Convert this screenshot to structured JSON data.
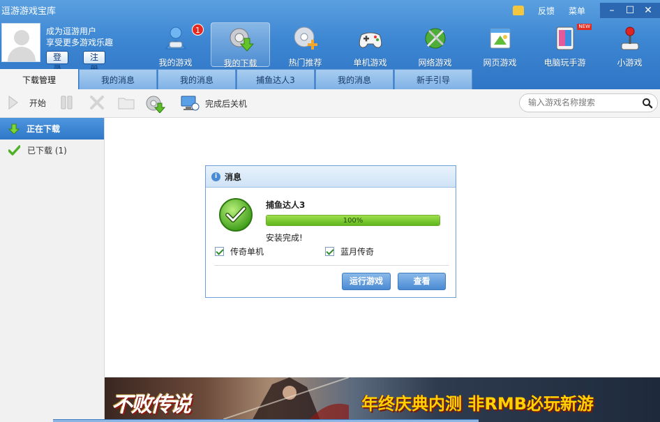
{
  "app": {
    "title": "逗游游戏宝库"
  },
  "system": {
    "feedback": "反馈",
    "menu": "菜单",
    "shirt_icon": "shirt-icon",
    "min": "–",
    "max": "☐",
    "close": "✕"
  },
  "user": {
    "line1": "成为逗游用户",
    "line2": "享受更多游戏乐趣",
    "login": "登录",
    "register": "注册"
  },
  "nav": [
    {
      "label": "我的游戏",
      "badge": "1",
      "icon": "my-games-icon"
    },
    {
      "label": "我的下载",
      "icon": "download-gear-icon",
      "active": true
    },
    {
      "label": "热门推荐",
      "icon": "hot-recommend-icon"
    },
    {
      "label": "单机游戏",
      "icon": "gamepad-icon"
    },
    {
      "label": "网络游戏",
      "icon": "sword-globe-icon"
    },
    {
      "label": "网页游戏",
      "icon": "web-game-icon"
    },
    {
      "label": "电脑玩手游",
      "icon": "tablet-icon",
      "tag": "NEW"
    },
    {
      "label": "小游戏",
      "icon": "joystick-icon"
    }
  ],
  "tabs": [
    {
      "label": "下载管理",
      "active": true
    },
    {
      "label": "我的消息"
    },
    {
      "label": "我的消息"
    },
    {
      "label": "捕鱼达人3"
    },
    {
      "label": "我的消息"
    },
    {
      "label": "新手引导"
    }
  ],
  "toolbar": {
    "start": "开始",
    "shutdown_after": "完成后关机"
  },
  "search": {
    "placeholder": "输入游戏名称搜索"
  },
  "sidebar": {
    "downloading": "正在下载",
    "downloaded": "已下载 (1)"
  },
  "dialog": {
    "title": "消息",
    "game": "捕鱼达人3",
    "progress": 100,
    "progress_text": "100%",
    "status": "安装完成!",
    "option1": "传奇单机",
    "option2": "蓝月传奇",
    "run_button": "运行游戏",
    "view_button": "查看"
  },
  "banner": {
    "logo": "不败传说",
    "slogan": "年终庆典内测 非RMB必玩新游"
  }
}
